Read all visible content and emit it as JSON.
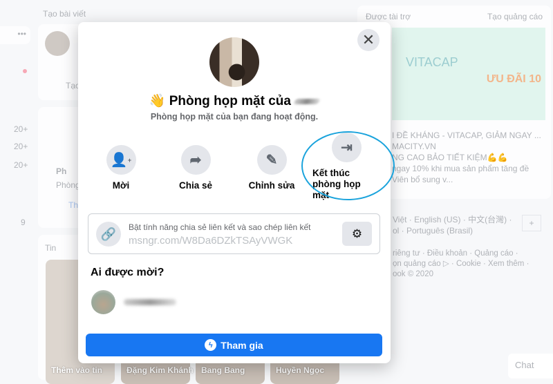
{
  "background": {
    "create_post": "Tạo bài viết",
    "create_short": "Tạo",
    "rooms_title_short": "Ph",
    "rooms_sub_short": "Phòng",
    "join_short": "Th",
    "stories": "Tin",
    "counts": [
      "20+",
      "20+",
      "20+",
      "9"
    ],
    "sponsored": "Được tài trợ",
    "create_ad": "Tạo quảng cáo",
    "ad_headline": "I ĐỀ KHÁNG - VITACAP, GIẢM NGAY ...",
    "ad_domain": "MACITY.VN",
    "ad_line1": "NG CAO BẢO TIẾT KIỆM💪💪",
    "ad_line2": "ngay 10% khi mua sản phẩm tăng đề",
    "ad_line3": "Viên bổ sung v...",
    "ad_brand": "VITACAP",
    "ad_promo": "ƯU ĐÃI 10",
    "languages": "Việt · English (US) · 中文(台灣) ·",
    "languages2": "ol · Português (Brasil)",
    "footer1": "riêng tư · Điều khoản · Quảng cáo ·",
    "footer2": "ọn quảng cáo ▷ · Cookie · Xem thêm ·",
    "footer3": "ook © 2020",
    "story_names": [
      "Thêm vào tin",
      "Đặng Kim Khánh",
      "Bang Bang",
      "Huyền Ngọc"
    ],
    "chat": "Chat"
  },
  "modal": {
    "title": "Phòng họp mặt của",
    "title_emoji": "👋",
    "subtitle": "Phòng họp mặt của bạn đang hoạt động.",
    "actions": [
      {
        "label": "Mời",
        "icon": "add-person-icon"
      },
      {
        "label": "Chia sẻ",
        "icon": "share-icon"
      },
      {
        "label": "Chỉnh sửa",
        "icon": "pencil-icon"
      },
      {
        "label": "Kết thúc phòng họp mặt",
        "icon": "exit-icon"
      }
    ],
    "link_hint": "Bật tính năng chia sẻ liên kết và sao chép liên kết",
    "link_url": "msngr.com/W8Da6DZkTSAyVWGK",
    "invited_heading": "Ai được mời?",
    "join_label": "Tham gia"
  },
  "colors": {
    "accent": "#1877f2",
    "highlight_ring": "#1aa3dc"
  }
}
